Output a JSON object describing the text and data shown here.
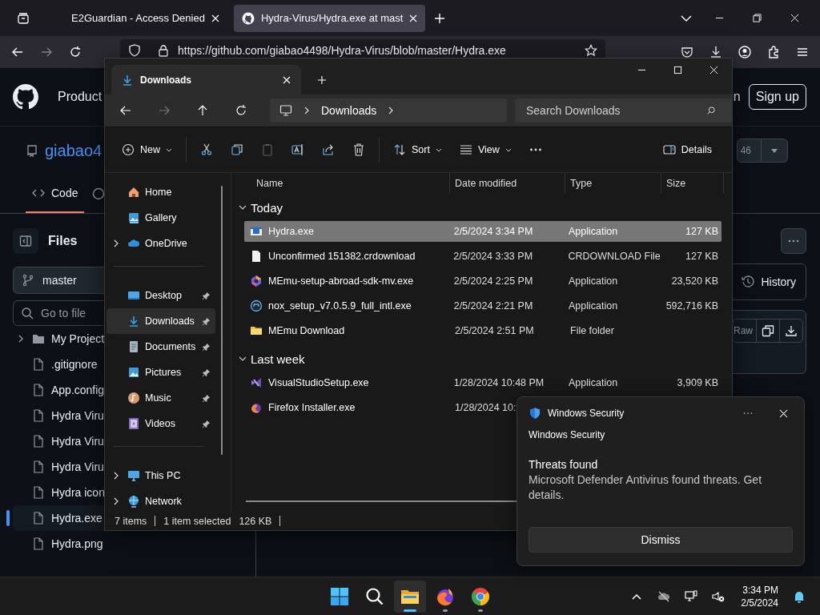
{
  "browser": {
    "tabs": [
      {
        "title": "E2Guardian - Access Denied",
        "kind": "blank",
        "selected": false
      },
      {
        "title": "Hydra-Virus/Hydra.exe at mast",
        "kind": "github",
        "selected": true
      }
    ],
    "url": "https://github.com/giabao4498/Hydra-Virus/blob/master/Hydra.exe"
  },
  "github": {
    "header": {
      "nav_item": "Product",
      "sign_in": "n",
      "sign_up": "Sign up"
    },
    "repo": {
      "name": "giabao4",
      "counter": "46"
    },
    "tabs": [
      {
        "label": "Code",
        "selected": true
      }
    ],
    "sidebar": {
      "title": "Files",
      "branch": "master",
      "search_placeholder": "Go to file",
      "tree": [
        {
          "name": "My Project",
          "kind": "folder",
          "selected": false
        },
        {
          "name": ".gitignore",
          "kind": "file",
          "selected": false
        },
        {
          "name": "App.config",
          "kind": "file",
          "selected": false
        },
        {
          "name": "Hydra Viru",
          "kind": "file",
          "selected": false
        },
        {
          "name": "Hydra Viru",
          "kind": "file",
          "selected": false
        },
        {
          "name": "Hydra Viru",
          "kind": "file",
          "selected": false
        },
        {
          "name": "Hydra icon",
          "kind": "file",
          "selected": false
        },
        {
          "name": "Hydra.exe",
          "kind": "file",
          "selected": true
        },
        {
          "name": "Hydra.png",
          "kind": "file",
          "selected": false
        }
      ]
    },
    "actions": {
      "history": "History",
      "raw": "Raw"
    }
  },
  "explorer": {
    "tab_title": "Downloads",
    "breadcrumb": [
      "Downloads"
    ],
    "search_placeholder": "Search Downloads",
    "nav_buttons": [
      {
        "kind": "back",
        "disabled": false
      },
      {
        "kind": "forward",
        "disabled": true
      },
      {
        "kind": "up",
        "disabled": false
      },
      {
        "kind": "refresh",
        "disabled": false
      }
    ],
    "commands": [
      {
        "kind": "new",
        "label": "New",
        "disabled": false
      },
      {
        "kind": "cut",
        "disabled": false
      },
      {
        "kind": "copy",
        "disabled": false
      },
      {
        "kind": "paste",
        "disabled": true
      },
      {
        "kind": "rename",
        "disabled": false
      },
      {
        "kind": "share",
        "disabled": false
      },
      {
        "kind": "delete",
        "disabled": false
      },
      {
        "kind": "sort",
        "label": "Sort",
        "disabled": false
      },
      {
        "kind": "view",
        "label": "View",
        "disabled": false
      },
      {
        "kind": "more",
        "disabled": false
      }
    ],
    "details_label": "Details",
    "nav_sections": [
      {
        "items": [
          {
            "label": "Home",
            "kind": "home",
            "expandable": false,
            "pinned": false,
            "selected": false
          },
          {
            "label": "Gallery",
            "kind": "gallery",
            "expandable": false,
            "pinned": false,
            "selected": false
          },
          {
            "label": "OneDrive",
            "kind": "cloud",
            "expandable": true,
            "pinned": false,
            "selected": false
          }
        ]
      },
      {
        "items": [
          {
            "label": "Desktop",
            "kind": "desktop",
            "expandable": false,
            "pinned": true,
            "selected": false
          },
          {
            "label": "Downloads",
            "kind": "download",
            "expandable": false,
            "pinned": true,
            "selected": true
          },
          {
            "label": "Documents",
            "kind": "documents",
            "expandable": false,
            "pinned": true,
            "selected": false
          },
          {
            "label": "Pictures",
            "kind": "pictures",
            "expandable": false,
            "pinned": true,
            "selected": false
          },
          {
            "label": "Music",
            "kind": "music",
            "expandable": false,
            "pinned": true,
            "selected": false
          },
          {
            "label": "Videos",
            "kind": "videos",
            "expandable": false,
            "pinned": true,
            "selected": false
          }
        ]
      },
      {
        "items": [
          {
            "label": "This PC",
            "kind": "pc",
            "expandable": true,
            "pinned": false,
            "selected": false
          },
          {
            "label": "Network",
            "kind": "network",
            "expandable": true,
            "pinned": false,
            "selected": false
          }
        ]
      }
    ],
    "columns": [
      "Name",
      "Date modified",
      "Type",
      "Size"
    ],
    "groups": [
      {
        "title": "Today",
        "expanded": true,
        "files": [
          {
            "name": "Hydra.exe",
            "date": "2/5/2024 3:34 PM",
            "type": "Application",
            "size": "127 KB",
            "kind": "exe",
            "selected": true
          },
          {
            "name": "Unconfirmed 151382.crdownload",
            "date": "2/5/2024 3:33 PM",
            "type": "CRDOWNLOAD File",
            "size": "127 KB",
            "kind": "file",
            "selected": false
          },
          {
            "name": "MEmu-setup-abroad-sdk-mv.exe",
            "date": "2/5/2024 2:25 PM",
            "type": "Application",
            "size": "23,520 KB",
            "kind": "hexagon",
            "selected": false
          },
          {
            "name": "nox_setup_v7.0.5.9_full_intl.exe",
            "date": "2/5/2024 2:21 PM",
            "type": "Application",
            "size": "592,716 KB",
            "kind": "ring",
            "selected": false
          },
          {
            "name": "MEmu Download",
            "date": "2/5/2024 2:51 PM",
            "type": "File folder",
            "kind": "folder",
            "selected": false
          }
        ]
      },
      {
        "title": "Last week",
        "expanded": true,
        "files": [
          {
            "name": "VisualStudioSetup.exe",
            "date": "1/28/2024 10:48 PM",
            "type": "Application",
            "size": "3,909 KB",
            "kind": "ribbon",
            "selected": false
          },
          {
            "name": "Firefox Installer.exe",
            "date": "1/28/2024 10:",
            "kind": "fox",
            "selected": false
          }
        ]
      }
    ],
    "status": {
      "count": "7 items",
      "selection": "1 item selected",
      "size": "126 KB"
    }
  },
  "toast": {
    "app": "Windows Security",
    "source": "Windows Security",
    "heading": "Threats found",
    "body": "Microsoft Defender Antivirus found threats. Get details.",
    "button": "Dismiss"
  },
  "taskbar": {
    "apps": [
      {
        "kind": "start",
        "running": false,
        "active": false
      },
      {
        "kind": "search",
        "running": false,
        "active": false
      },
      {
        "kind": "explorer",
        "running": true,
        "active": true
      },
      {
        "kind": "firefox",
        "running": true,
        "active": false
      },
      {
        "kind": "chrome",
        "running": true,
        "active": false
      }
    ],
    "time": "3:34 PM",
    "date": "2/5/2024"
  }
}
